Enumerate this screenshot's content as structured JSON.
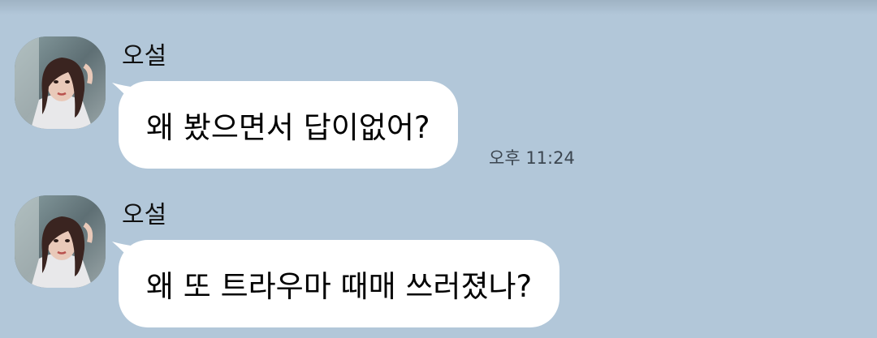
{
  "chat": {
    "messages": [
      {
        "sender": "오설",
        "text": "왜 봤으면서 답이없어?",
        "time": "오후 11:24"
      },
      {
        "sender": "오설",
        "text": "왜 또 트라우마 때매 쓰러졌나?"
      }
    ]
  },
  "colors": {
    "background": "#b2c7d9",
    "bubble": "#ffffff",
    "time_text": "#3c4650"
  },
  "icons": [
    "profile-avatar"
  ]
}
